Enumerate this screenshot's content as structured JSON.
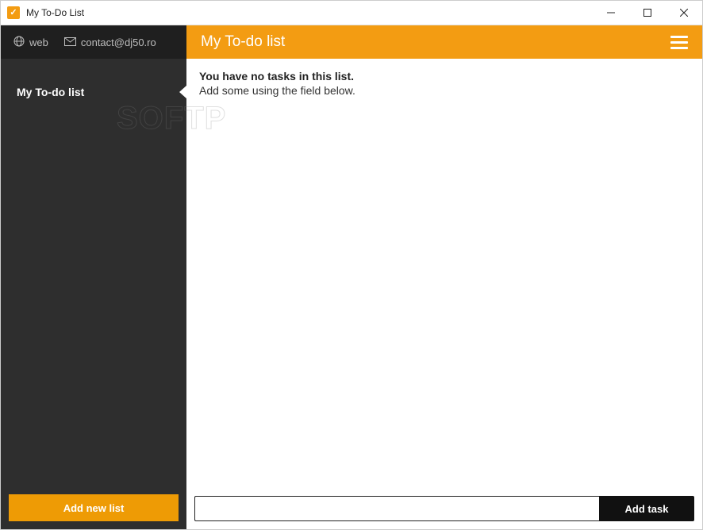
{
  "window": {
    "title": "My To-Do List"
  },
  "sidebar": {
    "links": {
      "web": "web",
      "contact": "contact@dj50.ro"
    },
    "items": [
      {
        "label": "My To-do list"
      }
    ],
    "add_list_label": "Add new list"
  },
  "main": {
    "title": "My To-do list",
    "empty_title": "You have no tasks in this list.",
    "empty_sub": "Add some using the field below.",
    "task_input_value": "",
    "add_task_label": "Add task"
  },
  "watermark": "SOFTP"
}
